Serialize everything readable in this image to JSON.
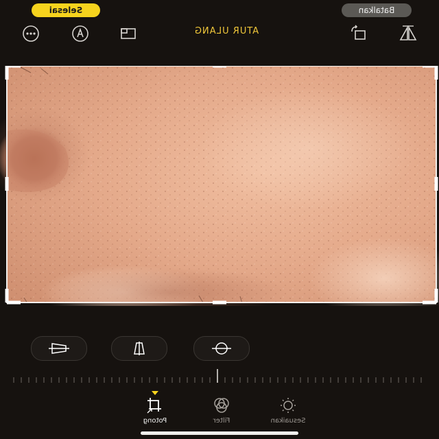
{
  "header": {
    "done_label": "Selesai",
    "cancel_label": "Batalkan"
  },
  "toolbar": {
    "reset_label": "ATUR ULANG",
    "icons": [
      "more-icon",
      "markup-pen-icon",
      "aspect-ratio-icon",
      "rotate-icon",
      "flip-icon"
    ]
  },
  "photo": {
    "description_icon": "skin-closeup-photo"
  },
  "rotation_controls": {
    "icons": [
      "horizontal-perspective-icon",
      "vertical-perspective-icon",
      "straighten-icon"
    ]
  },
  "modes": {
    "items": [
      {
        "label": "Potong",
        "icon": "crop-icon",
        "active": true
      },
      {
        "label": "Filter",
        "icon": "filter-icon",
        "active": false
      },
      {
        "label": "Sesuaikan",
        "icon": "adjust-icon",
        "active": false
      }
    ]
  },
  "colors": {
    "accent": "#f6d31d",
    "reset": "#f0c73a",
    "background": "#16120f",
    "skin": "#e7ad8d"
  }
}
